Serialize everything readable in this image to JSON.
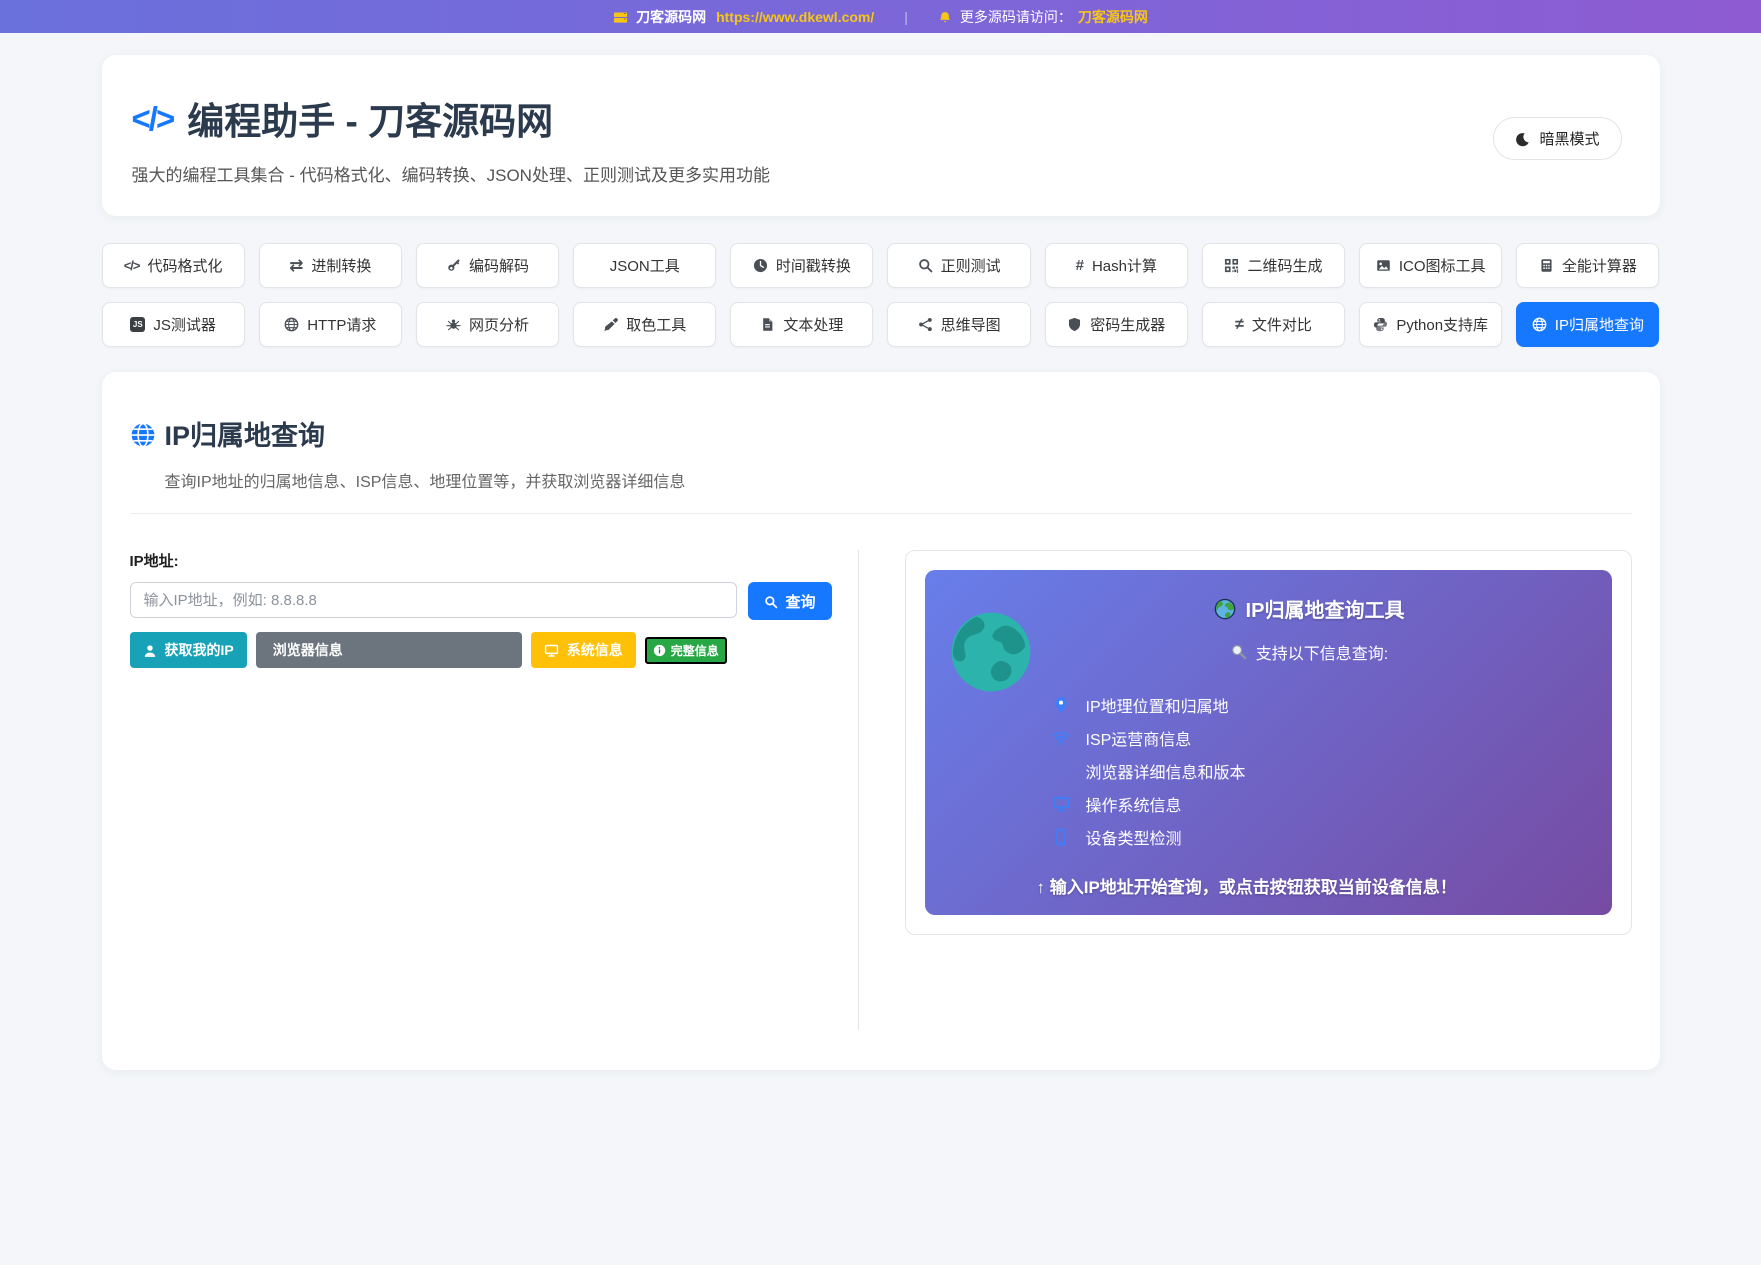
{
  "colors": {
    "accent_blue": "#1677ff",
    "teal": "#17a2b8",
    "gray": "#6c757d",
    "yellow": "#ffc107",
    "green": "#28a745",
    "topbar_gradient": [
      "#6a70dc",
      "#8e5bd2"
    ],
    "panel_gradient": [
      "#687eea",
      "#764ba2"
    ]
  },
  "topbar": {
    "site_name": "刀客源码网",
    "url": "https://www.dkewl.com/",
    "separator": "|",
    "promo_text": "更多源码请访问：",
    "promo_link": "刀客源码网"
  },
  "header": {
    "title": "编程助手 - 刀客源码网",
    "subtitle": "强大的编程工具集合 - 代码格式化、编码转换、JSON处理、正则测试及更多实用功能",
    "dark_mode_label": "暗黑模式"
  },
  "tools": {
    "items": [
      {
        "label": "代码格式化",
        "icon": "code",
        "active": false
      },
      {
        "label": "进制转换",
        "icon": "exchange",
        "active": false
      },
      {
        "label": "编码解码",
        "icon": "key",
        "active": false
      },
      {
        "label": "JSON工具",
        "icon": null,
        "active": false
      },
      {
        "label": "时间戳转换",
        "icon": "clock",
        "active": false
      },
      {
        "label": "正则测试",
        "icon": "search",
        "active": false
      },
      {
        "label": "Hash计算",
        "icon": "hash",
        "active": false
      },
      {
        "label": "二维码生成",
        "icon": "qrcode",
        "active": false
      },
      {
        "label": "ICO图标工具",
        "icon": "image",
        "active": false
      },
      {
        "label": "全能计算器",
        "icon": "calculator",
        "active": false
      },
      {
        "label": "JS测试器",
        "icon": "js",
        "active": false
      },
      {
        "label": "HTTP请求",
        "icon": "globe",
        "active": false
      },
      {
        "label": "网页分析",
        "icon": "bug",
        "active": false
      },
      {
        "label": "取色工具",
        "icon": "eyedropper",
        "active": false
      },
      {
        "label": "文本处理",
        "icon": "file",
        "active": false
      },
      {
        "label": "思维导图",
        "icon": "sitemap",
        "active": false
      },
      {
        "label": "密码生成器",
        "icon": "shield",
        "active": false
      },
      {
        "label": "文件对比",
        "icon": "notequal",
        "active": false
      },
      {
        "label": "Python支持库",
        "icon": "python",
        "active": false
      },
      {
        "label": "IP归属地查询",
        "icon": "globe",
        "active": true
      }
    ]
  },
  "main": {
    "title": "IP归属地查询",
    "subtitle": "查询IP地址的归属地信息、ISP信息、地理位置等，并获取浏览器详细信息",
    "form": {
      "label": "IP地址:",
      "placeholder": "输入IP地址，例如: 8.8.8.8",
      "query_button": "查询",
      "my_ip_button": "获取我的IP",
      "browser_button": "浏览器信息",
      "system_button": "系统信息",
      "full_button": "完整信息"
    },
    "panel": {
      "title": "IP归属地查询工具",
      "search_line": "支持以下信息查询:",
      "features": [
        {
          "icon": "marker",
          "text": "IP地理位置和归属地"
        },
        {
          "icon": "wifi",
          "text": "ISP运营商信息"
        },
        {
          "icon": null,
          "text": "浏览器详细信息和版本"
        },
        {
          "icon": "monitor",
          "text": "操作系统信息"
        },
        {
          "icon": "mobile",
          "text": "设备类型检测"
        }
      ],
      "footer": "↑ 输入IP地址开始查询，或点击按钮获取当前设备信息！"
    }
  }
}
